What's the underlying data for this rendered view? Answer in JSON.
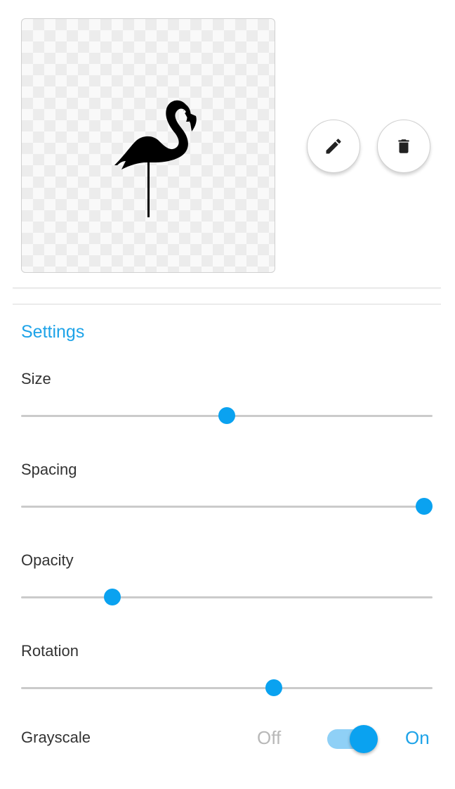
{
  "preview": {
    "image_icon": "flamingo-icon",
    "edit_icon": "pencil-icon",
    "delete_icon": "trash-icon"
  },
  "settings": {
    "title": "Settings",
    "size": {
      "label": "Size",
      "value": 0.5
    },
    "spacing": {
      "label": "Spacing",
      "value": 1.0
    },
    "opacity": {
      "label": "Opacity",
      "value": 0.21
    },
    "rotation": {
      "label": "Rotation",
      "value": 0.62
    },
    "grayscale": {
      "label": "Grayscale",
      "off_label": "Off",
      "on_label": "On",
      "enabled": true
    }
  },
  "colors": {
    "accent": "#0aa2f0",
    "accent_text": "#1ea3e8",
    "switch_track": "#8fd0f6"
  }
}
